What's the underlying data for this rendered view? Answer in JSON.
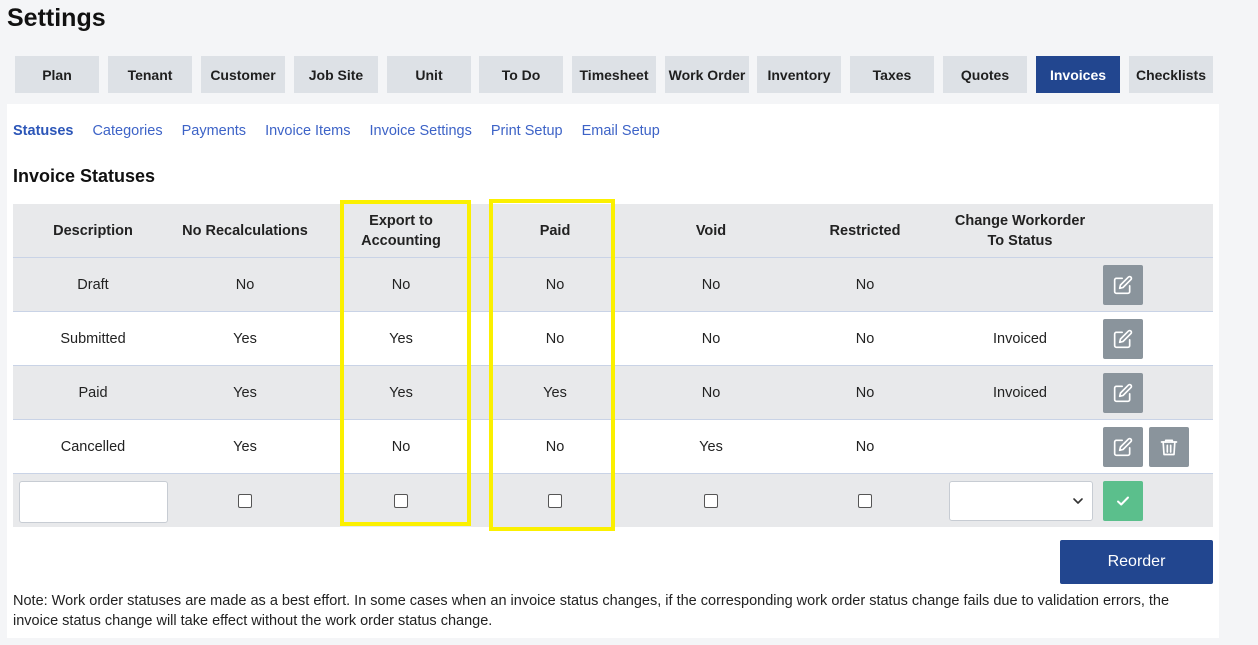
{
  "page": {
    "title": "Settings"
  },
  "tabs": [
    {
      "label": "Plan"
    },
    {
      "label": "Tenant"
    },
    {
      "label": "Customer"
    },
    {
      "label": "Job Site"
    },
    {
      "label": "Unit"
    },
    {
      "label": "To Do"
    },
    {
      "label": "Timesheet"
    },
    {
      "label": "Work Order"
    },
    {
      "label": "Inventory"
    },
    {
      "label": "Taxes"
    },
    {
      "label": "Quotes"
    },
    {
      "label": "Invoices"
    },
    {
      "label": "Checklists"
    }
  ],
  "active_tab": "Invoices",
  "subnav": [
    {
      "label": "Statuses"
    },
    {
      "label": "Categories"
    },
    {
      "label": "Payments"
    },
    {
      "label": "Invoice Items"
    },
    {
      "label": "Invoice Settings"
    },
    {
      "label": "Print Setup"
    },
    {
      "label": "Email Setup"
    }
  ],
  "active_subnav": "Statuses",
  "section": {
    "title": "Invoice Statuses"
  },
  "table": {
    "columns": [
      {
        "label": "Description"
      },
      {
        "label": "No Recalculations"
      },
      {
        "label": "Export to Accounting",
        "l1": "Export to",
        "l2": "Accounting"
      },
      {
        "label": "Paid"
      },
      {
        "label": "Void"
      },
      {
        "label": "Restricted"
      },
      {
        "label": "Change Workorder To Status",
        "l1": "Change Workorder",
        "l2": "To Status"
      }
    ],
    "rows": [
      {
        "description": "Draft",
        "no_recalculations": "No",
        "export_to_accounting": "No",
        "paid": "No",
        "void": "No",
        "restricted": "No",
        "change_workorder_status": ""
      },
      {
        "description": "Submitted",
        "no_recalculations": "Yes",
        "export_to_accounting": "Yes",
        "paid": "No",
        "void": "No",
        "restricted": "No",
        "change_workorder_status": "Invoiced"
      },
      {
        "description": "Paid",
        "no_recalculations": "Yes",
        "export_to_accounting": "Yes",
        "paid": "Yes",
        "void": "No",
        "restricted": "No",
        "change_workorder_status": "Invoiced"
      },
      {
        "description": "Cancelled",
        "no_recalculations": "Yes",
        "export_to_accounting": "No",
        "paid": "No",
        "void": "Yes",
        "restricted": "No",
        "change_workorder_status": ""
      }
    ]
  },
  "new_row": {
    "description_value": "",
    "change_status_selected": ""
  },
  "actions": {
    "reorder_label": "Reorder"
  },
  "note": "Note: Work order statuses are made as a best effort. In some cases when an invoice status changes, if the corresponding work order status change fails due to validation errors, the invoice status change will take effect without the work order status change.",
  "colors": {
    "primary": "#22468f",
    "highlight": "#fbf000",
    "link": "#3d63c7",
    "edit_button": "#8a949c",
    "confirm_button": "#5bbf8c"
  },
  "icons": {
    "edit": "edit-icon",
    "delete": "trash-icon",
    "confirm": "checkmark-icon",
    "dropdown": "chevron-down-icon"
  }
}
